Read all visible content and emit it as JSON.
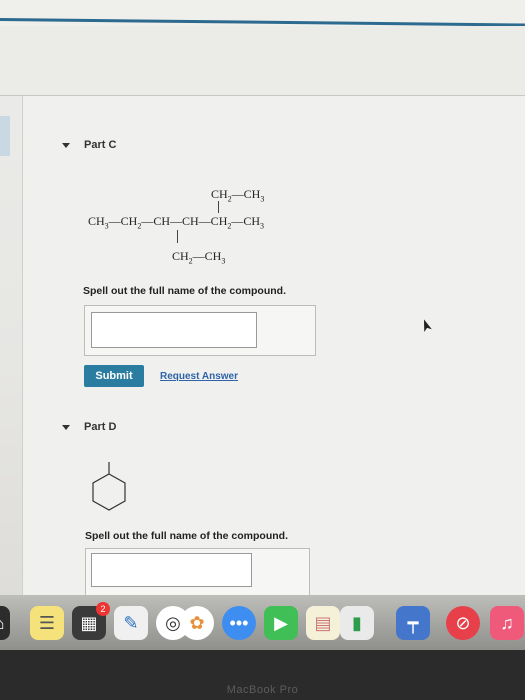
{
  "partC": {
    "header": "Part C",
    "structure": {
      "top_branch": [
        "CH",
        "2",
        "—CH",
        "3"
      ],
      "main_chain": [
        "CH",
        "3",
        "—CH",
        "2",
        "—CH—CH—CH",
        "2",
        "—CH",
        "3"
      ],
      "bottom_branch": [
        "CH",
        "2",
        "—CH",
        "3"
      ]
    },
    "prompt": "Spell out the full name of the compound.",
    "submit_label": "Submit",
    "request_label": "Request Answer"
  },
  "partD": {
    "header": "Part D",
    "prompt": "Spell out the full name of the compound."
  },
  "dock": {
    "badge": "2",
    "icons": [
      "notes-icon",
      "launchpad-icon",
      "calendar-icon",
      "preview-icon",
      "chrome-icon",
      "photos-icon",
      "messages-icon",
      "facetime-icon",
      "stickies-icon",
      "numbers-icon",
      "keynote-icon",
      "news-icon",
      "music-icon"
    ]
  },
  "device_label": "MacBook Pro",
  "colors": {
    "accent": "#2a7ca1",
    "link": "#2e63a8",
    "topline": "#2d6a8f"
  }
}
